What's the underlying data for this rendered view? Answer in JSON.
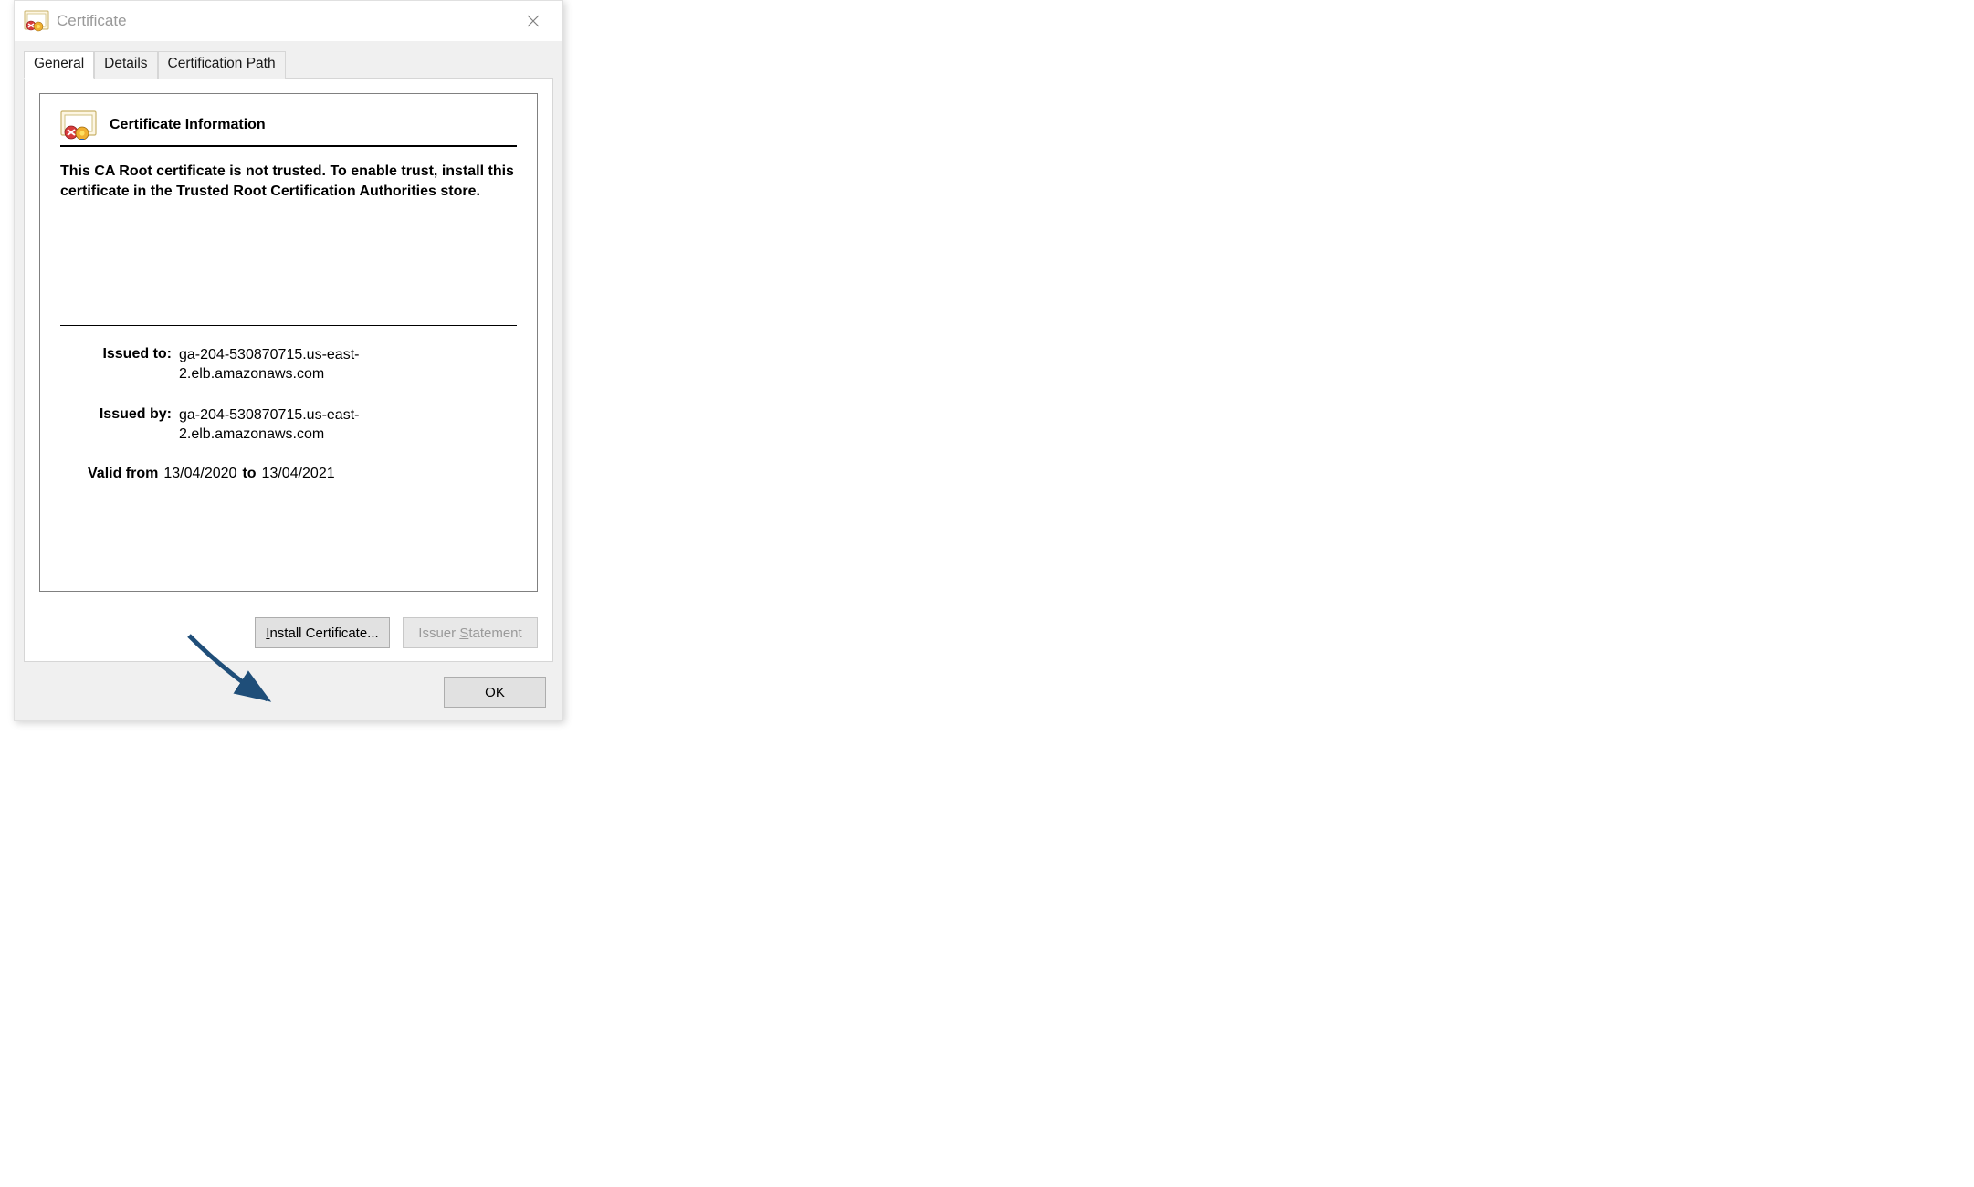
{
  "window": {
    "title": "Certificate"
  },
  "tabs": {
    "general": "General",
    "details": "Details",
    "certpath": "Certification Path"
  },
  "heading": "Certificate Information",
  "trust_message": "This CA Root certificate is not trusted. To enable trust, install this certificate in the Trusted Root Certification Authorities store.",
  "issued_to": {
    "label": "Issued to:",
    "value": "ga-204-530870715.us-east-2.elb.amazonaws.com"
  },
  "issued_by": {
    "label": "Issued by:",
    "value": "ga-204-530870715.us-east-2.elb.amazonaws.com"
  },
  "valid": {
    "from_label": "Valid from",
    "from_value": "13/04/2020",
    "to_label": "to",
    "to_value": "13/04/2021"
  },
  "buttons": {
    "install": "Install Certificate...",
    "issuer": "Issuer Statement",
    "ok": "OK"
  }
}
